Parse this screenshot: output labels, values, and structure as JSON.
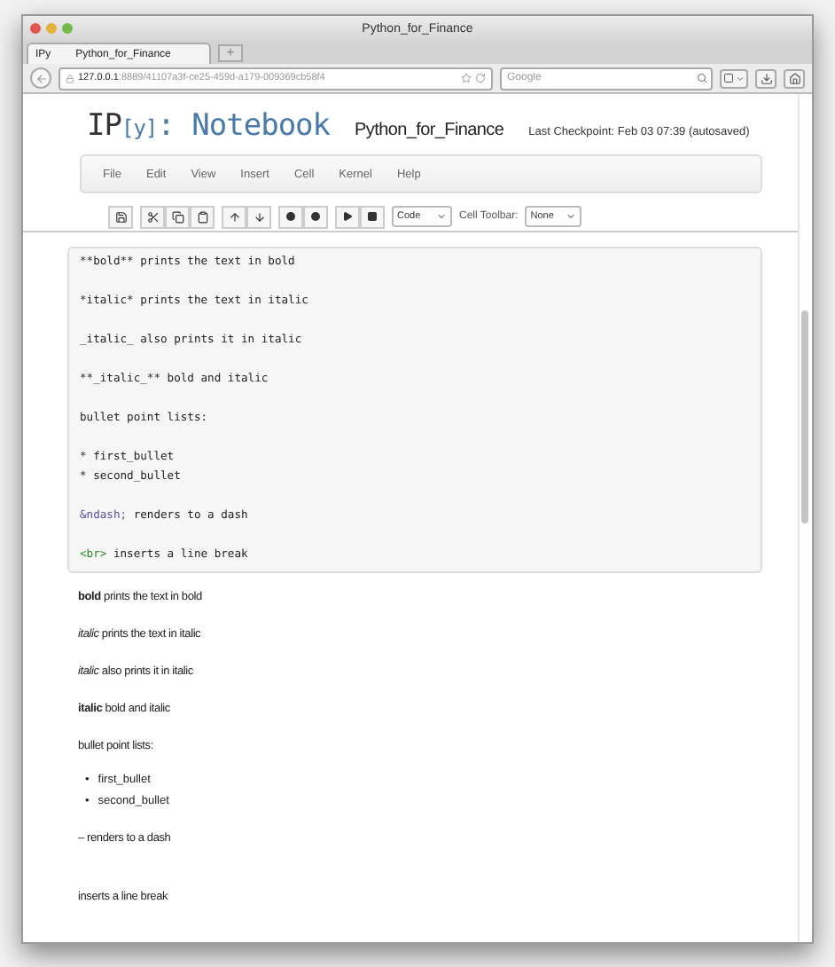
{
  "window": {
    "title": "Python_for_Finance"
  },
  "tabs": [
    {
      "favicon": "IPy",
      "label": "Python_for_Finance",
      "selected": true
    }
  ],
  "new_tab": "+",
  "address": {
    "host": "127.0.0.1",
    "rest": ":8889/41107a3f-ce25-459d-a179-009369cb58f4"
  },
  "search": {
    "placeholder": "Google"
  },
  "notebook": {
    "logo_main": "IP",
    "logo_bracket": "[y]",
    "logo_rest": ": Notebook",
    "name": "Python_for_Finance",
    "checkpoint": "Last Checkpoint: Feb 03 07:39 (autosaved)"
  },
  "menu": [
    "File",
    "Edit",
    "View",
    "Insert",
    "Cell",
    "Kernel",
    "Help"
  ],
  "toolbar": {
    "cell_type": "Code",
    "cell_toolbar_label": "Cell Toolbar:",
    "cell_toolbar_value": "None"
  },
  "source_lines": [
    [
      {
        "kind": "plain",
        "text": "**bold** prints the text in bold"
      }
    ],
    [
      {
        "kind": "plain",
        "text": "*italic* prints the text in italic"
      }
    ],
    [
      {
        "kind": "plain",
        "text": "_italic_ also prints it in italic"
      }
    ],
    [
      {
        "kind": "plain",
        "text": "**_italic_** bold and italic"
      }
    ],
    [
      {
        "kind": "plain",
        "text": "bullet point lists:"
      }
    ],
    [
      {
        "kind": "plain",
        "text": "* first_bullet"
      },
      {
        "kind": "break"
      },
      {
        "kind": "plain",
        "text": "* second_bullet"
      }
    ],
    [
      {
        "kind": "entity",
        "text": "&ndash;"
      },
      {
        "kind": "plain",
        "text": " renders to a dash"
      }
    ],
    [
      {
        "kind": "tag",
        "text": "<br>"
      },
      {
        "kind": "plain",
        "text": " inserts a line break"
      }
    ]
  ],
  "rendered": [
    {
      "kind": "para",
      "text": "**bold** prints the text in bold"
    },
    {
      "kind": "para",
      "text": "*italic* prints the text in italic"
    },
    {
      "kind": "para",
      "text": "*italic* also prints it in italic"
    },
    {
      "kind": "para",
      "text": "**italic** bold and italic"
    },
    {
      "kind": "para",
      "text": "bullet point lists:"
    },
    {
      "kind": "list",
      "items": [
        {
          "marker": "•",
          "text": "first_bullet"
        },
        {
          "marker": "•",
          "text": "second_bullet"
        }
      ]
    },
    {
      "kind": "para",
      "text": "– renders to a dash"
    },
    {
      "kind": "break"
    },
    {
      "kind": "para",
      "text": "inserts a line break"
    }
  ]
}
